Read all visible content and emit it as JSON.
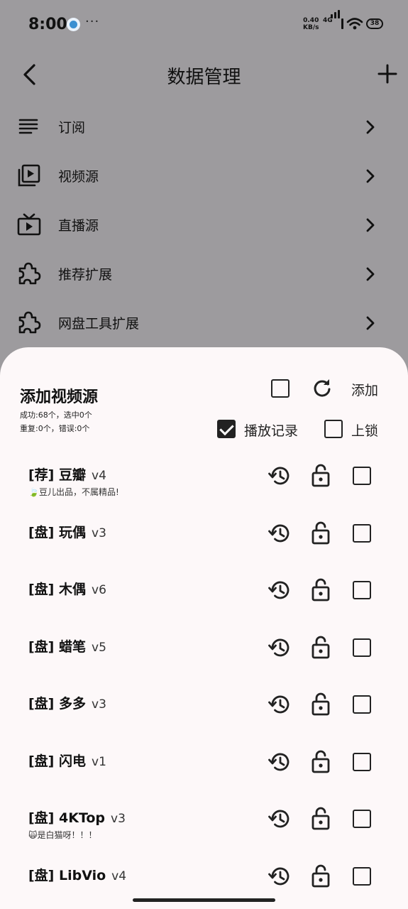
{
  "status": {
    "time": "8:00",
    "more": "···",
    "speed_line1": "0.40",
    "speed_line2": "KB/s",
    "network": "4G",
    "battery": "38"
  },
  "header": {
    "title": "数据管理"
  },
  "menu": [
    {
      "label": "订阅",
      "icon": "list-icon"
    },
    {
      "label": "视频源",
      "icon": "video-library-icon"
    },
    {
      "label": "直播源",
      "icon": "live-tv-icon"
    },
    {
      "label": "推荐扩展",
      "icon": "extension-icon"
    },
    {
      "label": "网盘工具扩展",
      "icon": "extension-icon"
    }
  ],
  "sheet": {
    "title": "添加视频源",
    "stats_line1": "成功:68个，选中0个",
    "stats_line2": "重复:0个，错误:0个",
    "add_label": "添加",
    "play_record_label": "播放记录",
    "play_record_checked": true,
    "lock_label": "上锁",
    "lock_checked": false,
    "select_all_checked": false
  },
  "sources": [
    {
      "tag": "[荐]",
      "name": "豆瓣",
      "version": "v4",
      "desc": "🍃豆儿出品，不属精品!"
    },
    {
      "tag": "[盘]",
      "name": "玩偶",
      "version": "v3",
      "desc": ""
    },
    {
      "tag": "[盘]",
      "name": "木偶",
      "version": "v6",
      "desc": ""
    },
    {
      "tag": "[盘]",
      "name": "蜡笔",
      "version": "v5",
      "desc": ""
    },
    {
      "tag": "[盘]",
      "name": "多多",
      "version": "v3",
      "desc": ""
    },
    {
      "tag": "[盘]",
      "name": "闪电",
      "version": "v1",
      "desc": ""
    },
    {
      "tag": "[盘]",
      "name": "4KTop",
      "version": "v3",
      "desc": "🙀是白猫呀！！！"
    },
    {
      "tag": "[盘]",
      "name": "LibVio",
      "version": "v4",
      "desc": ""
    }
  ]
}
